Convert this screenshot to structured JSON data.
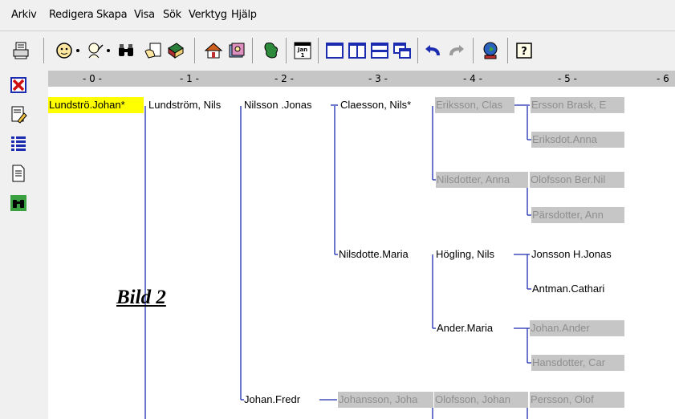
{
  "menu": [
    "Arkiv",
    "Redigera",
    "Skapa",
    "Visa",
    "Sök",
    "Verktyg",
    "Hjälp"
  ],
  "toolbar": {
    "buttons": [
      "print-icon",
      "person-icon",
      "person-search-icon",
      "binoculars-icon",
      "edit-hand-icon",
      "book-icon",
      "home-icon",
      "family-book-icon",
      "map-icon",
      "calendar-icon",
      "single-pane-icon",
      "two-pane-icon",
      "horizontal-split-icon",
      "window-cascade-icon",
      "undo-icon",
      "redo-icon",
      "globe-icon",
      "help-icon"
    ],
    "calendar_text": "Jan\n1",
    "help_text": "?"
  },
  "sidebar": [
    "delete-icon",
    "edit-notes-icon",
    "list-icon",
    "document-icon",
    "search-binoculars-icon"
  ],
  "ruler": [
    "- 0 -",
    "- 1 -",
    "- 2 -",
    "- 3 -",
    "- 4 -",
    "- 5 -",
    "- 6"
  ],
  "tree": [
    {
      "text": "Lundströ.Johan*",
      "style": "selected"
    },
    {
      "text": "Lundström, Nils",
      "style": "normal"
    },
    {
      "text": "Nilsson .Jonas",
      "style": "normal"
    },
    {
      "text": "Claesson, Nils*",
      "style": "normal"
    },
    {
      "text": "Eriksson, Clas",
      "style": "dim"
    },
    {
      "text": "Ersson Brask, E",
      "style": "dim"
    },
    {
      "text": "Eriksdot.Anna",
      "style": "dim"
    },
    {
      "text": "Nilsdotter, Anna",
      "style": "dim"
    },
    {
      "text": "Olofsson Ber.Nil",
      "style": "dim"
    },
    {
      "text": "Pärsdotter, Ann",
      "style": "dim"
    },
    {
      "text": "Nilsdotte.Maria",
      "style": "normal"
    },
    {
      "text": "Högling, Nils",
      "style": "normal"
    },
    {
      "text": "Jonsson H.Jonas",
      "style": "normal"
    },
    {
      "text": "Antman.Cathari",
      "style": "normal"
    },
    {
      "text": "Ander.Maria",
      "style": "normal"
    },
    {
      "text": "Johan.Ander",
      "style": "dim"
    },
    {
      "text": "Hansdotter, Car",
      "style": "dim"
    },
    {
      "text": "Johan.Fredr",
      "style": "normal"
    },
    {
      "text": "Johansson, Joha",
      "style": "dim"
    },
    {
      "text": "Olofsson, Johan",
      "style": "dim"
    },
    {
      "text": "Persson, Olof",
      "style": "dim"
    }
  ],
  "caption": "Bild 2"
}
